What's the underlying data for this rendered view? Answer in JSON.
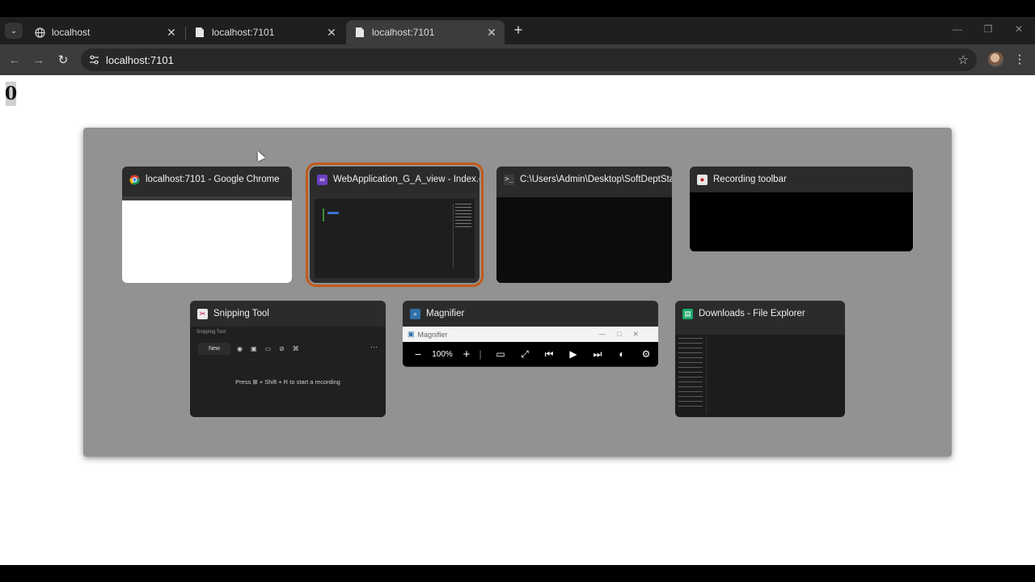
{
  "browser": {
    "tabs": [
      {
        "title": "localhost",
        "close": "✕"
      },
      {
        "title": "localhost:7101",
        "close": "✕"
      },
      {
        "title": "localhost:7101",
        "close": "✕"
      }
    ],
    "new_tab": "+",
    "address": "localhost:7101"
  },
  "page": {
    "counter": "0"
  },
  "switcher": {
    "windows": [
      {
        "title": "localhost:7101 - Google Chrome",
        "app": "chrome"
      },
      {
        "title": "WebApplication_G_A_view - Index.cs...",
        "app": "visual-studio",
        "selected": true
      },
      {
        "title": "C:\\Users\\Admin\\Desktop\\SoftDeptSta...",
        "app": "terminal"
      },
      {
        "title": "Recording toolbar",
        "app": "recording"
      },
      {
        "title": "Snipping Tool",
        "app": "snipping-tool"
      },
      {
        "title": "Magnifier",
        "app": "magnifier"
      },
      {
        "title": "Downloads - File Explorer",
        "app": "file-explorer"
      }
    ],
    "magnifier": {
      "title": "Magnifier",
      "zoom": "100%"
    },
    "snipping": {
      "new_label": "New",
      "message": "Press ⊞ + Shift + R to start a recording"
    }
  },
  "colors": {
    "selection_border": "#c25a1c",
    "switcher_bg": "#929292"
  }
}
